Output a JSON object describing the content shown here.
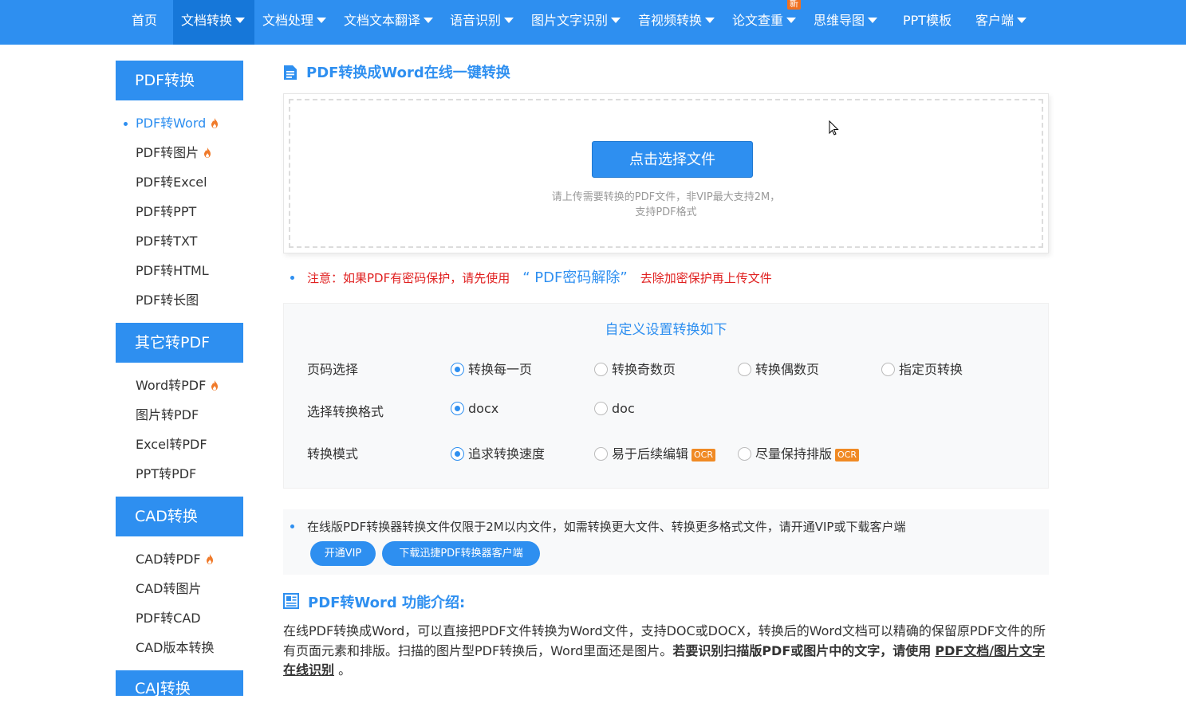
{
  "nav": {
    "items": [
      {
        "label": "首页",
        "dropdown": false
      },
      {
        "label": "文档转换",
        "dropdown": true
      },
      {
        "label": "文档处理",
        "dropdown": true
      },
      {
        "label": "文档文本翻译",
        "dropdown": true
      },
      {
        "label": "语音识别",
        "dropdown": true
      },
      {
        "label": "图片文字识别",
        "dropdown": true
      },
      {
        "label": "音视频转换",
        "dropdown": true
      },
      {
        "label": "论文查重",
        "dropdown": true,
        "badge": "新"
      },
      {
        "label": "思维导图",
        "dropdown": true
      },
      {
        "label": "PPT模板",
        "dropdown": false
      },
      {
        "label": "客户端",
        "dropdown": true
      }
    ],
    "active": "文档转换"
  },
  "sidebar": {
    "sections": [
      {
        "title": "PDF转换",
        "items": [
          {
            "label": "PDF转Word",
            "hot": true,
            "active": true
          },
          {
            "label": "PDF转图片",
            "hot": true
          },
          {
            "label": "PDF转Excel"
          },
          {
            "label": "PDF转PPT"
          },
          {
            "label": "PDF转TXT"
          },
          {
            "label": "PDF转HTML"
          },
          {
            "label": "PDF转长图"
          }
        ]
      },
      {
        "title": "其它转PDF",
        "items": [
          {
            "label": "Word转PDF",
            "hot": true
          },
          {
            "label": "图片转PDF"
          },
          {
            "label": "Excel转PDF"
          },
          {
            "label": "PPT转PDF"
          }
        ]
      },
      {
        "title": "CAD转换",
        "items": [
          {
            "label": "CAD转PDF",
            "hot": true
          },
          {
            "label": "CAD转图片"
          },
          {
            "label": "PDF转CAD"
          },
          {
            "label": "CAD版本转换"
          }
        ]
      },
      {
        "title": "CAJ转换",
        "items": []
      }
    ]
  },
  "main": {
    "title": "PDF转换成Word在线一键转换",
    "upload": {
      "button": "点击选择文件",
      "hint_line1": "请上传需要转换的PDF文件，非VIP最大支持2M，",
      "hint_line2": "支持PDF格式"
    },
    "note": {
      "prefix": "注意：如果PDF有密码保护，请先使用",
      "link": "“ PDF密码解除”",
      "suffix": "去除加密保护再上传文件"
    },
    "settings": {
      "title": "自定义设置转换如下",
      "rows": [
        {
          "label": "页码选择",
          "options": [
            {
              "label": "转换每一页",
              "checked": true
            },
            {
              "label": "转换奇数页"
            },
            {
              "label": "转换偶数页"
            },
            {
              "label": "指定页转换"
            }
          ]
        },
        {
          "label": "选择转换格式",
          "options": [
            {
              "label": "docx",
              "checked": true
            },
            {
              "label": "doc"
            }
          ]
        },
        {
          "label": "转换模式",
          "options": [
            {
              "label": "追求转换速度",
              "checked": true
            },
            {
              "label": "易于后续编辑",
              "badge": "OCR"
            },
            {
              "label": "尽量保持排版",
              "badge": "OCR"
            }
          ]
        }
      ]
    },
    "vip": {
      "text": "在线版PDF转换器转换文件仅限于2M以内文件，如需转换更大文件、转换更多格式文件，请开通VIP或下载客户端",
      "btn_vip": "开通VIP",
      "btn_download": "下载迅捷PDF转换器客户端"
    },
    "intro": {
      "title": "PDF转Word 功能介绍:",
      "text": "在线PDF转换成Word，可以直接把PDF文件转换为Word文件，支持DOC或DOCX，转换后的Word文档可以精确的保留原PDF文件的所有页面元素和排版。扫描的图片型PDF转换后，Word里面还是图片。",
      "bold": "若要识别扫描版PDF或图片中的文字，请使用",
      "link": "PDF文档/图片文字在线识别",
      "end": "。"
    }
  },
  "colors": {
    "primary": "#2e8ff0",
    "active_nav": "#1677d9",
    "warning": "#e02020",
    "ocr_badge": "#f08a24"
  }
}
